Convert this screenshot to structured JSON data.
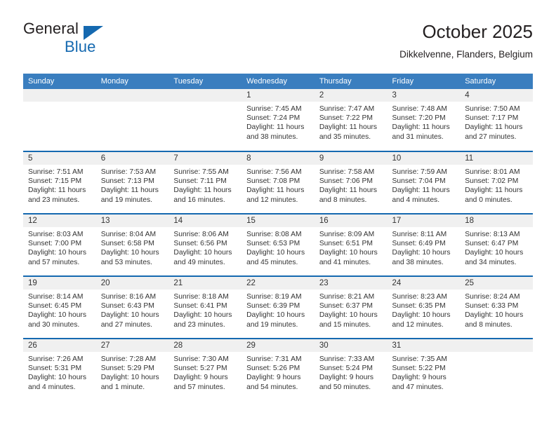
{
  "brand": {
    "name_part1": "General",
    "name_part2": "Blue",
    "flag_icon": "triangle-flag-icon",
    "accent_color": "#1569b0"
  },
  "header": {
    "title": "October 2025",
    "location": "Dikkelvenne, Flanders, Belgium"
  },
  "calendar": {
    "header_bg": "#3a7ebf",
    "grid_line_color": "#1569b0",
    "daynum_bg": "#f0f0f0",
    "weekdays": [
      "Sunday",
      "Monday",
      "Tuesday",
      "Wednesday",
      "Thursday",
      "Friday",
      "Saturday"
    ],
    "weeks": [
      [
        {
          "day": "",
          "lines": []
        },
        {
          "day": "",
          "lines": []
        },
        {
          "day": "",
          "lines": []
        },
        {
          "day": "1",
          "lines": [
            "Sunrise: 7:45 AM",
            "Sunset: 7:24 PM",
            "Daylight: 11 hours",
            "and 38 minutes."
          ]
        },
        {
          "day": "2",
          "lines": [
            "Sunrise: 7:47 AM",
            "Sunset: 7:22 PM",
            "Daylight: 11 hours",
            "and 35 minutes."
          ]
        },
        {
          "day": "3",
          "lines": [
            "Sunrise: 7:48 AM",
            "Sunset: 7:20 PM",
            "Daylight: 11 hours",
            "and 31 minutes."
          ]
        },
        {
          "day": "4",
          "lines": [
            "Sunrise: 7:50 AM",
            "Sunset: 7:17 PM",
            "Daylight: 11 hours",
            "and 27 minutes."
          ]
        }
      ],
      [
        {
          "day": "5",
          "lines": [
            "Sunrise: 7:51 AM",
            "Sunset: 7:15 PM",
            "Daylight: 11 hours",
            "and 23 minutes."
          ]
        },
        {
          "day": "6",
          "lines": [
            "Sunrise: 7:53 AM",
            "Sunset: 7:13 PM",
            "Daylight: 11 hours",
            "and 19 minutes."
          ]
        },
        {
          "day": "7",
          "lines": [
            "Sunrise: 7:55 AM",
            "Sunset: 7:11 PM",
            "Daylight: 11 hours",
            "and 16 minutes."
          ]
        },
        {
          "day": "8",
          "lines": [
            "Sunrise: 7:56 AM",
            "Sunset: 7:08 PM",
            "Daylight: 11 hours",
            "and 12 minutes."
          ]
        },
        {
          "day": "9",
          "lines": [
            "Sunrise: 7:58 AM",
            "Sunset: 7:06 PM",
            "Daylight: 11 hours",
            "and 8 minutes."
          ]
        },
        {
          "day": "10",
          "lines": [
            "Sunrise: 7:59 AM",
            "Sunset: 7:04 PM",
            "Daylight: 11 hours",
            "and 4 minutes."
          ]
        },
        {
          "day": "11",
          "lines": [
            "Sunrise: 8:01 AM",
            "Sunset: 7:02 PM",
            "Daylight: 11 hours",
            "and 0 minutes."
          ]
        }
      ],
      [
        {
          "day": "12",
          "lines": [
            "Sunrise: 8:03 AM",
            "Sunset: 7:00 PM",
            "Daylight: 10 hours",
            "and 57 minutes."
          ]
        },
        {
          "day": "13",
          "lines": [
            "Sunrise: 8:04 AM",
            "Sunset: 6:58 PM",
            "Daylight: 10 hours",
            "and 53 minutes."
          ]
        },
        {
          "day": "14",
          "lines": [
            "Sunrise: 8:06 AM",
            "Sunset: 6:56 PM",
            "Daylight: 10 hours",
            "and 49 minutes."
          ]
        },
        {
          "day": "15",
          "lines": [
            "Sunrise: 8:08 AM",
            "Sunset: 6:53 PM",
            "Daylight: 10 hours",
            "and 45 minutes."
          ]
        },
        {
          "day": "16",
          "lines": [
            "Sunrise: 8:09 AM",
            "Sunset: 6:51 PM",
            "Daylight: 10 hours",
            "and 41 minutes."
          ]
        },
        {
          "day": "17",
          "lines": [
            "Sunrise: 8:11 AM",
            "Sunset: 6:49 PM",
            "Daylight: 10 hours",
            "and 38 minutes."
          ]
        },
        {
          "day": "18",
          "lines": [
            "Sunrise: 8:13 AM",
            "Sunset: 6:47 PM",
            "Daylight: 10 hours",
            "and 34 minutes."
          ]
        }
      ],
      [
        {
          "day": "19",
          "lines": [
            "Sunrise: 8:14 AM",
            "Sunset: 6:45 PM",
            "Daylight: 10 hours",
            "and 30 minutes."
          ]
        },
        {
          "day": "20",
          "lines": [
            "Sunrise: 8:16 AM",
            "Sunset: 6:43 PM",
            "Daylight: 10 hours",
            "and 27 minutes."
          ]
        },
        {
          "day": "21",
          "lines": [
            "Sunrise: 8:18 AM",
            "Sunset: 6:41 PM",
            "Daylight: 10 hours",
            "and 23 minutes."
          ]
        },
        {
          "day": "22",
          "lines": [
            "Sunrise: 8:19 AM",
            "Sunset: 6:39 PM",
            "Daylight: 10 hours",
            "and 19 minutes."
          ]
        },
        {
          "day": "23",
          "lines": [
            "Sunrise: 8:21 AM",
            "Sunset: 6:37 PM",
            "Daylight: 10 hours",
            "and 15 minutes."
          ]
        },
        {
          "day": "24",
          "lines": [
            "Sunrise: 8:23 AM",
            "Sunset: 6:35 PM",
            "Daylight: 10 hours",
            "and 12 minutes."
          ]
        },
        {
          "day": "25",
          "lines": [
            "Sunrise: 8:24 AM",
            "Sunset: 6:33 PM",
            "Daylight: 10 hours",
            "and 8 minutes."
          ]
        }
      ],
      [
        {
          "day": "26",
          "lines": [
            "Sunrise: 7:26 AM",
            "Sunset: 5:31 PM",
            "Daylight: 10 hours",
            "and 4 minutes."
          ]
        },
        {
          "day": "27",
          "lines": [
            "Sunrise: 7:28 AM",
            "Sunset: 5:29 PM",
            "Daylight: 10 hours",
            "and 1 minute."
          ]
        },
        {
          "day": "28",
          "lines": [
            "Sunrise: 7:30 AM",
            "Sunset: 5:27 PM",
            "Daylight: 9 hours",
            "and 57 minutes."
          ]
        },
        {
          "day": "29",
          "lines": [
            "Sunrise: 7:31 AM",
            "Sunset: 5:26 PM",
            "Daylight: 9 hours",
            "and 54 minutes."
          ]
        },
        {
          "day": "30",
          "lines": [
            "Sunrise: 7:33 AM",
            "Sunset: 5:24 PM",
            "Daylight: 9 hours",
            "and 50 minutes."
          ]
        },
        {
          "day": "31",
          "lines": [
            "Sunrise: 7:35 AM",
            "Sunset: 5:22 PM",
            "Daylight: 9 hours",
            "and 47 minutes."
          ]
        },
        {
          "day": "",
          "lines": []
        }
      ]
    ]
  }
}
